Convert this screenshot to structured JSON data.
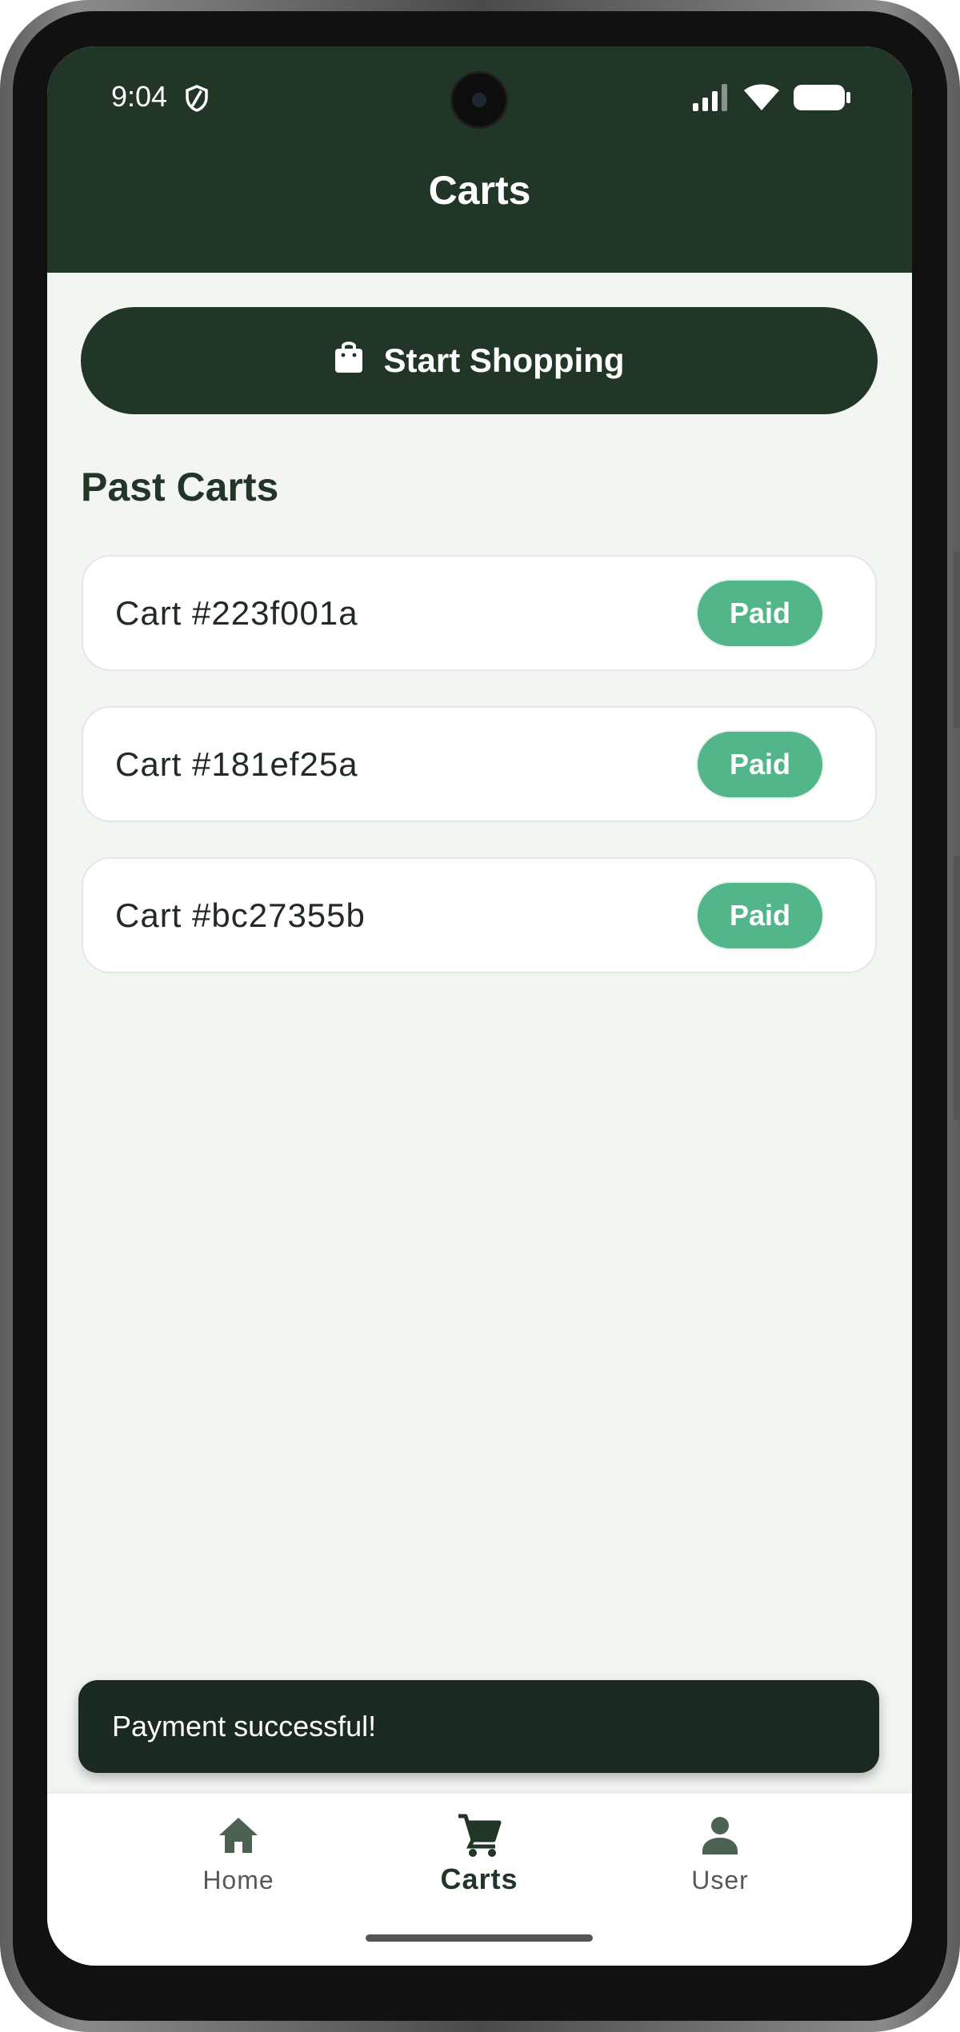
{
  "status_bar": {
    "time": "9:04",
    "icons": [
      "shield-icon",
      "signal-icon",
      "wifi-icon",
      "battery-icon"
    ]
  },
  "app_bar": {
    "title": "Carts"
  },
  "start_button": {
    "label": "Start Shopping",
    "icon": "shopping-bag-icon"
  },
  "past_carts": {
    "title": "Past Carts",
    "items": [
      {
        "name": "Cart #223f001a",
        "status": "Paid"
      },
      {
        "name": "Cart #181ef25a",
        "status": "Paid"
      },
      {
        "name": "Cart #bc27355b",
        "status": "Paid"
      }
    ]
  },
  "snackbar": {
    "message": "Payment successful!"
  },
  "bottom_nav": {
    "items": [
      {
        "label": "Home",
        "icon": "home-icon",
        "active": false
      },
      {
        "label": "Carts",
        "icon": "cart-icon",
        "active": true
      },
      {
        "label": "User",
        "icon": "user-icon",
        "active": false
      }
    ]
  },
  "colors": {
    "primary_dark_green": "#223628",
    "background": "#f3f5f3",
    "paid_badge": "#52b68a",
    "snackbar": "#1b2a20"
  }
}
